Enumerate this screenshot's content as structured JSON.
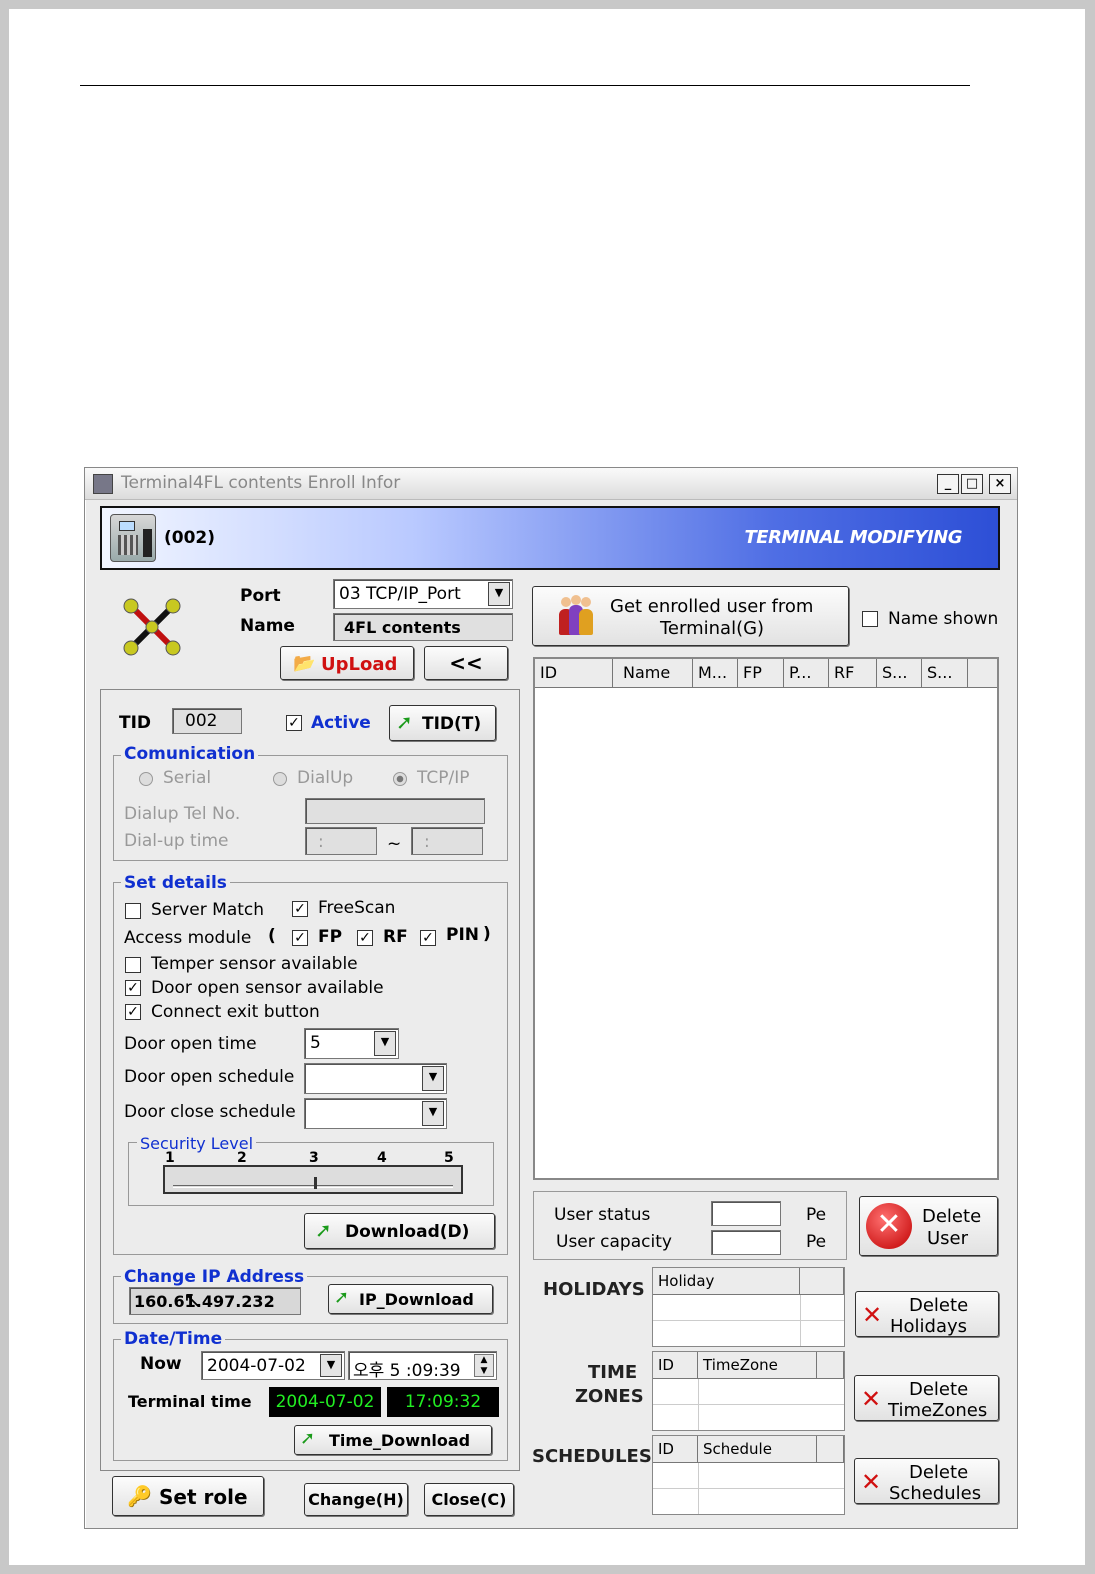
{
  "window": {
    "title": "Terminal4FL contents Enroll Infor",
    "minimize": "_",
    "maximize": "□",
    "close": "×"
  },
  "banner": {
    "terminal_id": "(002)",
    "mode": "TERMINAL MODIFYING"
  },
  "terminal": {
    "port_label": "Port",
    "port_value": "03 TCP/IP_Port",
    "name_label": "Name",
    "name_value": "4FL contents",
    "upload_button": "UpLoad",
    "collapse_button": "<<"
  },
  "tid": {
    "label": "TID",
    "value": "002",
    "active_label": "Active",
    "active_checked": true,
    "button": "TID(T)"
  },
  "communication": {
    "title": "Comunication",
    "options": [
      "Serial",
      "DialUp",
      "TCP/IP"
    ],
    "selected": "TCP/IP",
    "dialup_tel_label": "Dialup Tel No.",
    "dialup_time_label": "Dial-up time",
    "time_separator": "~",
    "time_from": ":",
    "time_to": ":"
  },
  "set_details": {
    "title": "Set details",
    "server_match": {
      "label": "Server Match",
      "checked": false
    },
    "freescan": {
      "label": "FreeScan",
      "checked": true
    },
    "access_module_label": "Access module",
    "paren_open": "(",
    "paren_close": ")",
    "fp": {
      "label": "FP",
      "checked": true
    },
    "rf": {
      "label": "RF",
      "checked": true
    },
    "pin": {
      "label": "PIN",
      "checked": true
    },
    "temper": {
      "label": "Temper sensor available",
      "checked": false
    },
    "door_sensor": {
      "label": "Door open sensor available",
      "checked": true
    },
    "exit_button": {
      "label": "Connect exit button",
      "checked": true
    },
    "door_open_time_label": "Door open time",
    "door_open_time_value": "5",
    "door_open_schedule_label": "Door open schedule",
    "door_open_schedule_value": "",
    "door_close_schedule_label": "Door close schedule",
    "door_close_schedule_value": "",
    "security_level_title": "Security Level",
    "security_ticks": [
      "1",
      "2",
      "3",
      "4",
      "5"
    ],
    "security_level": 3,
    "download_button": "Download(D)"
  },
  "change_ip": {
    "title": "Change IP Address",
    "value": "160.61.497.232",
    "button": "IP_Download"
  },
  "datetime": {
    "title": "Date/Time",
    "now_label": "Now",
    "now_date": "2004-07-02",
    "now_time": "오후 5 :09:39",
    "terminal_label": "Terminal time",
    "terminal_date": "2004-07-02",
    "terminal_time": "17:09:32",
    "button": "Time_Download"
  },
  "bottom_buttons": {
    "set_role": "Set role",
    "change": "Change(H)",
    "close": "Close(C)"
  },
  "users": {
    "get_button_line1": "Get enrolled user from",
    "get_button_line2": "Terminal(G)",
    "name_shown_label": "Name shown",
    "name_shown_checked": false,
    "columns": [
      "ID",
      "Name",
      "M...",
      "FP",
      "P...",
      "RF",
      "S...",
      "S..."
    ]
  },
  "status": {
    "user_status_label": "User status",
    "user_capacity_label": "User capacity",
    "user_status_value": "",
    "user_capacity_value": "",
    "unit1": "Pe",
    "unit2": "Pe",
    "delete_user_line1": "Delete",
    "delete_user_line2": "User"
  },
  "holidays": {
    "label": "HOLIDAYS",
    "column": "Holiday",
    "delete_line1": "Delete",
    "delete_line2": "Holidays"
  },
  "timezones": {
    "label_line1": "TIME",
    "label_line2": "ZONES",
    "columns": [
      "ID",
      "TimeZone"
    ],
    "delete_line1": "Delete",
    "delete_line2": "TimeZones"
  },
  "schedules": {
    "label": "SCHEDULES",
    "columns": [
      "ID",
      "Schedule"
    ],
    "delete_line1": "Delete",
    "delete_line2": "Schedules"
  }
}
